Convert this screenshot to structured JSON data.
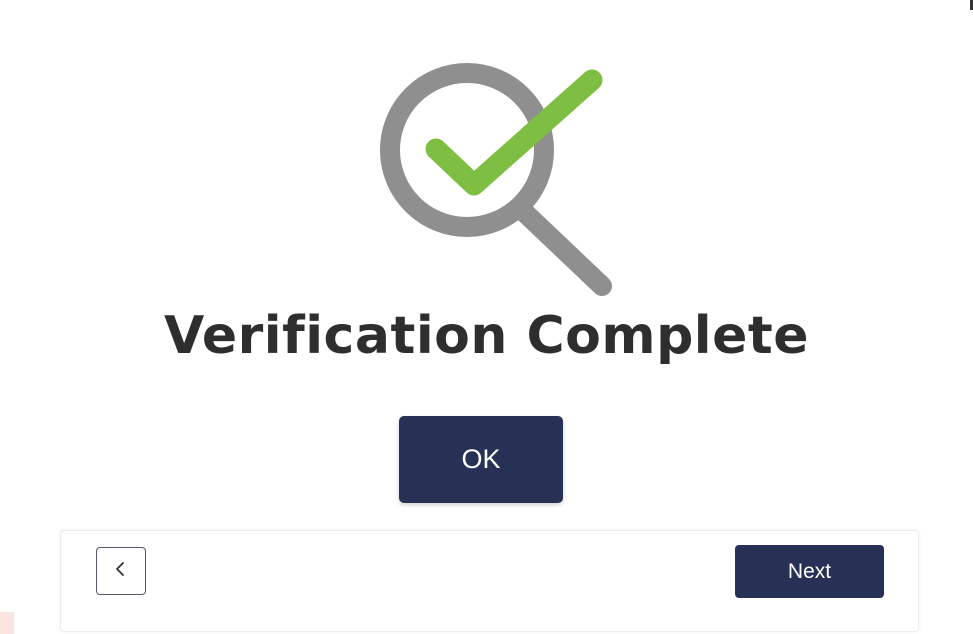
{
  "verification": {
    "title": "Verification Complete",
    "icon": "magnifier-check-icon",
    "colors": {
      "magnifier": "#8f8f8f",
      "check": "#7ebf43"
    }
  },
  "dialog": {
    "ok_label": "OK",
    "ok_color": "#273155"
  },
  "footer": {
    "back_icon": "chevron-left-icon",
    "next_label": "Next",
    "next_color": "#273155"
  }
}
